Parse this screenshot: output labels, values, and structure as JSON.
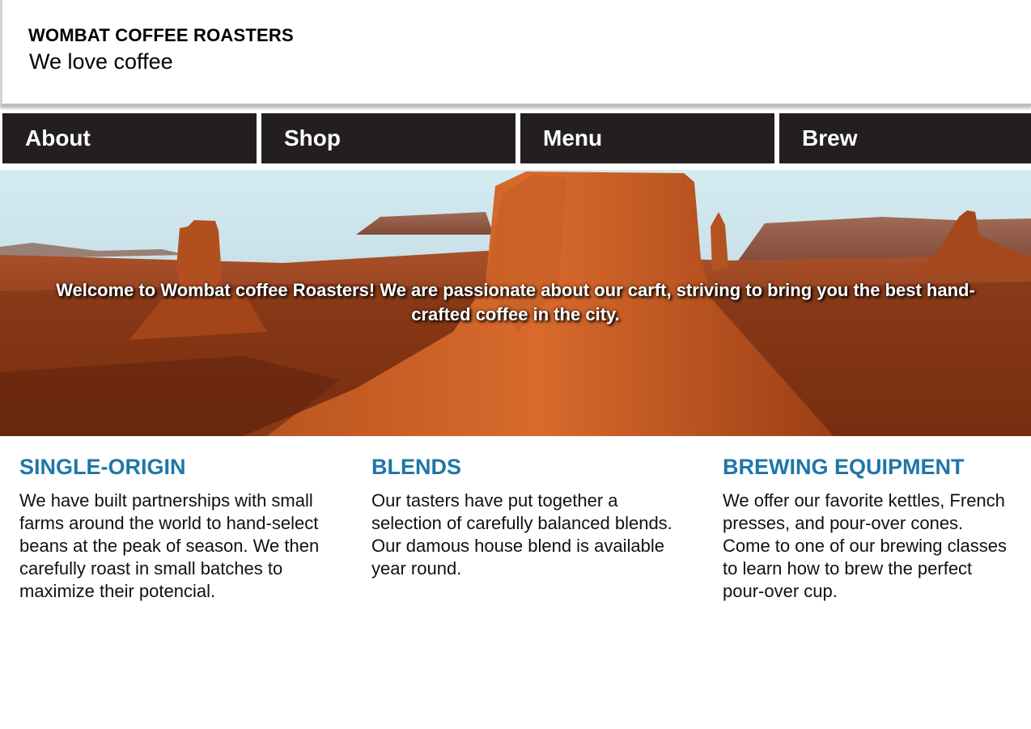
{
  "header": {
    "brand": "WOMBAT COFFEE ROASTERS",
    "tagline": "We love coffee"
  },
  "nav": {
    "items": [
      {
        "label": "About"
      },
      {
        "label": "Shop"
      },
      {
        "label": "Menu"
      },
      {
        "label": "Brew"
      }
    ]
  },
  "hero": {
    "text": "Welcome to Wombat coffee Roasters! We are passionate about our carft, striving to bring you the best hand-crafted coffee in the city."
  },
  "features": [
    {
      "title": "SINGLE-ORIGIN",
      "body": "We have built partnerships with small farms around the world to hand-select beans at the peak of season. We then carefully roast in small batches to maximize their potencial."
    },
    {
      "title": "BLENDS",
      "body": "Our tasters have put together a selection of carefully balanced blends. Our damous house blend is available year round."
    },
    {
      "title": "BREWING EQUIPMENT",
      "body": "We offer our favorite kettles, French presses, and pour-over cones. Come to one of our brewing classes to learn how to brew the perfect pour-over cup."
    }
  ],
  "colors": {
    "nav_background": "#231f1f",
    "feature_title": "#1f76a8",
    "text": "#111111"
  }
}
